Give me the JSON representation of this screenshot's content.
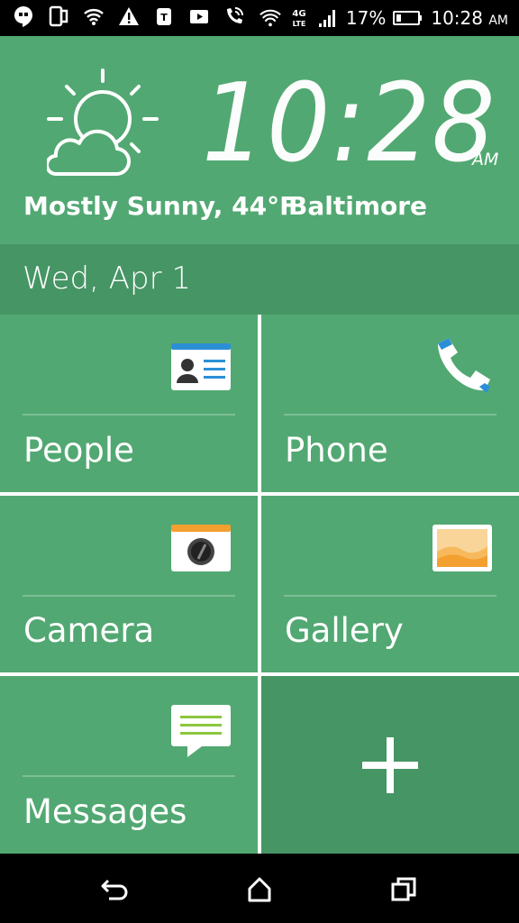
{
  "status_bar": {
    "battery_percent": "17%",
    "time": "10:28",
    "am_pm": "AM",
    "network": "4G LTE",
    "icons": [
      "hangouts-icon",
      "screen-mirror-icon",
      "wifi-icon",
      "warning-icon",
      "tmobile-icon",
      "video-icon",
      "wifi-calling-icon",
      "wifi-strong-icon",
      "lte-icon",
      "signal-icon",
      "battery-icon"
    ]
  },
  "clock": {
    "time": "10:28",
    "am_pm": "AM"
  },
  "weather": {
    "condition": "Mostly Sunny, 44°F",
    "city": "Baltimore",
    "icon": "partly-sunny-icon"
  },
  "date": "Wed, Apr 1",
  "tiles": [
    {
      "label": "People",
      "icon": "contact-card-icon"
    },
    {
      "label": "Phone",
      "icon": "phone-icon"
    },
    {
      "label": "Camera",
      "icon": "camera-icon"
    },
    {
      "label": "Gallery",
      "icon": "gallery-icon"
    },
    {
      "label": "Messages",
      "icon": "messages-icon"
    },
    {
      "label": "",
      "icon": "plus-icon"
    }
  ],
  "nav": {
    "back": "back-icon",
    "home": "home-icon",
    "recents": "recents-icon"
  },
  "colors": {
    "tile_green": "#52a872",
    "dark_green": "#469565",
    "icon_orange": "#f3a030",
    "icon_blue": "#2c8fd6"
  }
}
